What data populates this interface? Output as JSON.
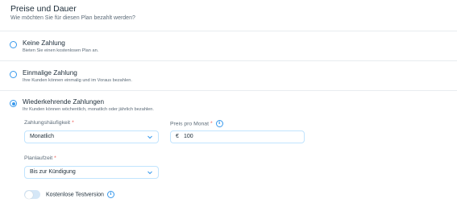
{
  "section": {
    "title": "Preise und Dauer",
    "subtitle": "Wie möchten Sie für diesen Plan bezahlt werden?"
  },
  "options": [
    {
      "title": "Keine Zahlung",
      "description": "Bieten Sie einen kostenlosen Plan an.",
      "selected": false
    },
    {
      "title": "Einmalige Zahlung",
      "description": "Ihre Kunden können einmalig und im Voraus bezahlen.",
      "selected": false
    },
    {
      "title": "Wiederkehrende Zahlungen",
      "description": "Ihr Kunden können wöchentlich, monatlich oder jährlich bezahlen.",
      "selected": true
    }
  ],
  "frequency": {
    "label": "Zahlungshäufigkeit",
    "required_mark": "*",
    "value": "Monatlich"
  },
  "price": {
    "label": "Preis pro Monat",
    "required_mark": "*",
    "currency": "€",
    "value": "100",
    "info_icon": "info-icon"
  },
  "duration": {
    "label": "Planlaufzeit",
    "required_mark": "*",
    "value": "Bis zur Kündigung"
  },
  "trial": {
    "label": "Kostenlose Testversion",
    "enabled": false,
    "info_icon": "info-icon"
  },
  "colors": {
    "accent": "#3899ec",
    "required": "#ee5951",
    "text": "#20303c",
    "muted": "#5c6b78"
  }
}
